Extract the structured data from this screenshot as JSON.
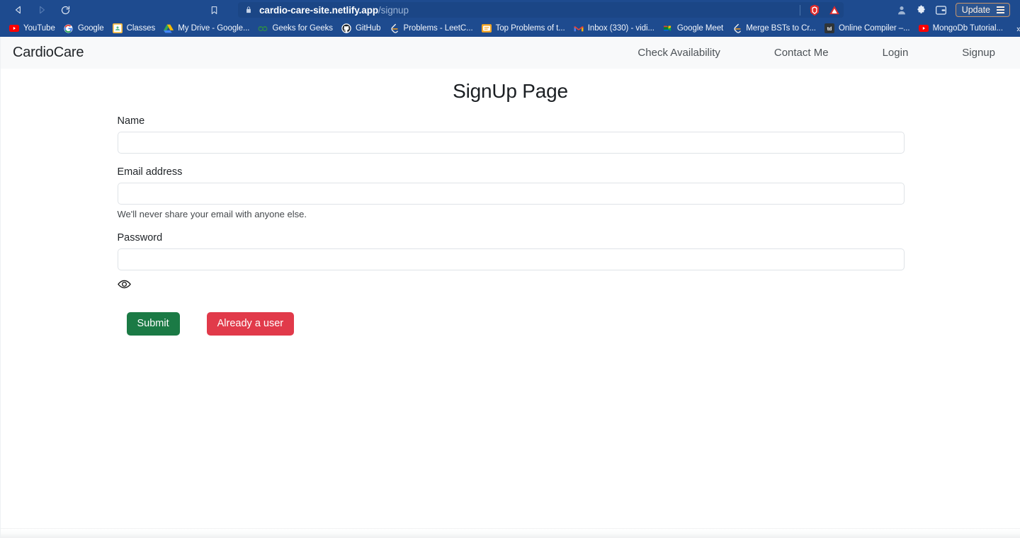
{
  "browser": {
    "nav": {
      "back_icon": "back-arrow-icon",
      "forward_icon": "forward-arrow-icon",
      "reload_icon": "reload-icon",
      "bookmark_icon": "bookmark-icon"
    },
    "omnibox": {
      "lock_icon": "lock-icon",
      "url_domain": "cardio-care-site.netlify.app",
      "url_path": "/signup",
      "brave_icon": "brave-shields-icon",
      "alert_icon": "warning-triangle-icon"
    },
    "toolbar_right": {
      "extension_icon": "extension-puzzle-icon",
      "profile_icon": "user-profile-icon",
      "wallet_icon": "wallet-icon",
      "update_label": "Update",
      "menu_icon": "hamburger-menu-icon"
    },
    "bookmarks": [
      {
        "label": "YouTube",
        "icon": "youtube-icon",
        "color": "#ff0000"
      },
      {
        "label": "Google",
        "icon": "google-icon",
        "color": "#ffffff"
      },
      {
        "label": "Classes",
        "icon": "google-classroom-icon",
        "color": "#f0b429"
      },
      {
        "label": "My Drive - Google...",
        "icon": "google-drive-icon",
        "color": "#1fa463"
      },
      {
        "label": "Geeks for Geeks",
        "icon": "geeksforgeeks-icon",
        "color": "#2f8d46"
      },
      {
        "label": "GitHub",
        "icon": "github-icon",
        "color": "#ffffff"
      },
      {
        "label": "Problems - LeetC...",
        "icon": "leetcode-icon",
        "color": "#f89f1b"
      },
      {
        "label": "Top Problems of t...",
        "icon": "notebook-icon",
        "color": "#f5a623"
      },
      {
        "label": "Inbox (330) - vidi...",
        "icon": "gmail-icon",
        "color": "#ea4335"
      },
      {
        "label": "Google Meet",
        "icon": "google-meet-icon",
        "color": "#00ac47"
      },
      {
        "label": "Merge BSTs to Cr...",
        "icon": "leetcode-icon",
        "color": "#f89f1b"
      },
      {
        "label": "Online Compiler –...",
        "icon": "tutorialspoint-icon",
        "color": "#2f3437"
      },
      {
        "label": "MongoDb Tutorial...",
        "icon": "youtube-icon",
        "color": "#ff0000"
      }
    ],
    "bookmarks_overflow": "»"
  },
  "site": {
    "navbar": {
      "brand": "CardioCare",
      "links": [
        {
          "label": "Check Availability"
        },
        {
          "label": "Contact Me"
        },
        {
          "label": "Login"
        },
        {
          "label": "Signup"
        }
      ]
    },
    "page_title": "SignUp Page",
    "form": {
      "name": {
        "label": "Name",
        "value": "",
        "placeholder": ""
      },
      "email": {
        "label": "Email address",
        "value": "",
        "placeholder": "",
        "help": "We'll never share your email with anyone else."
      },
      "password": {
        "label": "Password",
        "value": "",
        "placeholder": "",
        "toggle_icon": "eye-icon"
      },
      "submit_label": "Submit",
      "already_user_label": "Already a user"
    },
    "colors": {
      "submit_green": "#1b7a45",
      "already_red": "#e13a4a",
      "navbar_bg": "#f8f9fa",
      "browser_blue": "#1e4b8f"
    }
  }
}
